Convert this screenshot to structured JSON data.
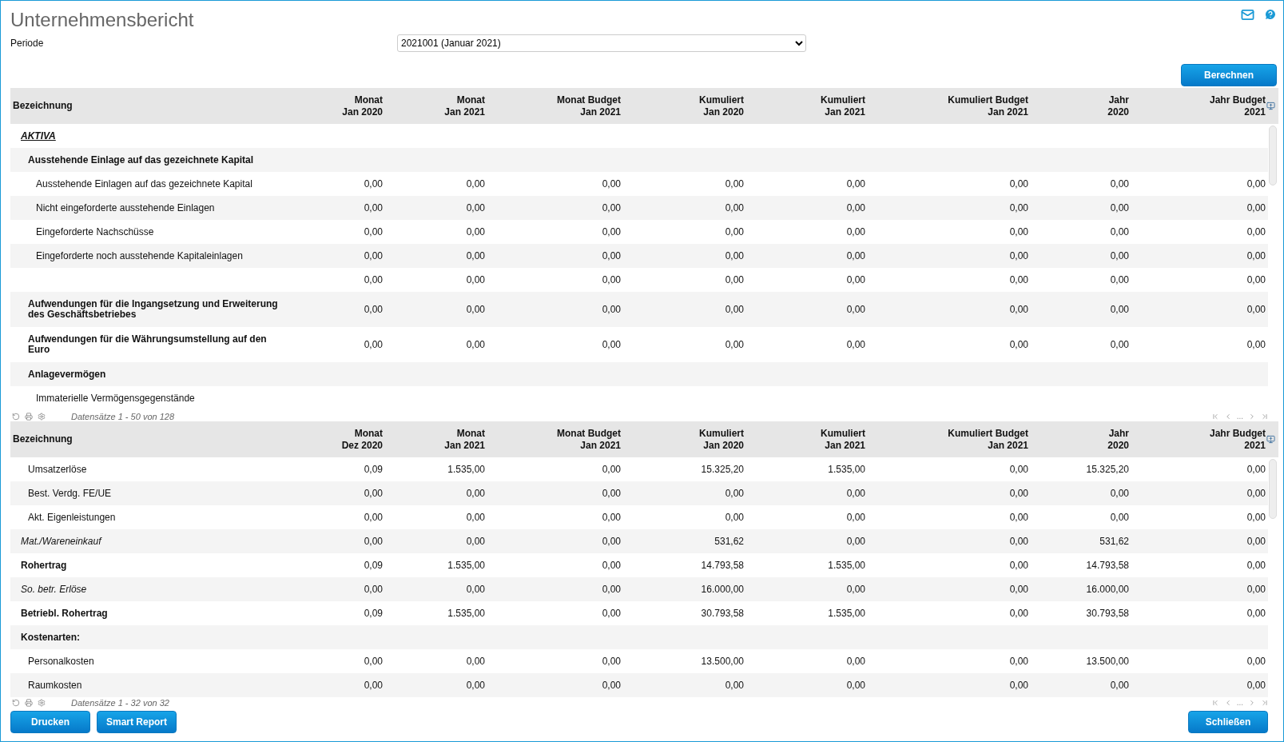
{
  "title": "Unternehmensbericht",
  "period": {
    "label": "Periode",
    "value": "2021001 (Januar 2021)"
  },
  "calculate_button": "Berechnen",
  "tables": [
    {
      "columns": [
        [
          "Bezeichnung"
        ],
        [
          "Monat",
          "Jan 2020"
        ],
        [
          "Monat",
          "Jan 2021"
        ],
        [
          "Monat Budget",
          "Jan 2021"
        ],
        [
          "Kumuliert",
          "Jan 2020"
        ],
        [
          "Kumuliert",
          "Jan 2021"
        ],
        [
          "Kumuliert Budget",
          "Jan 2021"
        ],
        [
          "Jahr",
          "2020"
        ],
        [
          "Jahr Budget",
          "2021"
        ]
      ],
      "rows": [
        {
          "kind": "section",
          "label": "AKTIVA"
        },
        {
          "kind": "group",
          "label": "Ausstehende Einlage auf das gezeichnete Kapital"
        },
        {
          "kind": "item",
          "label": "Ausstehende Einlagen auf das gezeichnete Kapital",
          "values": [
            "0,00",
            "0,00",
            "0,00",
            "0,00",
            "0,00",
            "0,00",
            "0,00",
            "0,00"
          ]
        },
        {
          "kind": "item",
          "label": "Nicht eingeforderte ausstehende Einlagen",
          "values": [
            "0,00",
            "0,00",
            "0,00",
            "0,00",
            "0,00",
            "0,00",
            "0,00",
            "0,00"
          ]
        },
        {
          "kind": "item",
          "label": "Eingeforderte Nachschüsse",
          "values": [
            "0,00",
            "0,00",
            "0,00",
            "0,00",
            "0,00",
            "0,00",
            "0,00",
            "0,00"
          ]
        },
        {
          "kind": "item",
          "label": "Eingeforderte noch ausstehende Kapitaleinlagen",
          "values": [
            "0,00",
            "0,00",
            "0,00",
            "0,00",
            "0,00",
            "0,00",
            "0,00",
            "0,00"
          ]
        },
        {
          "kind": "item",
          "values": [
            "0,00",
            "0,00",
            "0,00",
            "0,00",
            "0,00",
            "0,00",
            "0,00",
            "0,00"
          ]
        },
        {
          "kind": "group",
          "label": "Aufwendungen für die Ingangsetzung und Erweiterung des Geschäftsbetriebes",
          "values": [
            "0,00",
            "0,00",
            "0,00",
            "0,00",
            "0,00",
            "0,00",
            "0,00",
            "0,00"
          ]
        },
        {
          "kind": "group",
          "label": "Aufwendungen für die Währungsumstellung auf den Euro",
          "values": [
            "0,00",
            "0,00",
            "0,00",
            "0,00",
            "0,00",
            "0,00",
            "0,00",
            "0,00"
          ]
        },
        {
          "kind": "group",
          "label": "Anlagevermögen"
        },
        {
          "kind": "item",
          "label": "Immaterielle Vermögensgegenstände"
        }
      ],
      "records": "Datensätze 1 - 50 von 128"
    },
    {
      "columns": [
        [
          "Bezeichnung"
        ],
        [
          "Monat",
          "Dez 2020"
        ],
        [
          "Monat",
          "Jan 2021"
        ],
        [
          "Monat Budget",
          "Jan 2021"
        ],
        [
          "Kumuliert",
          "Jan 2020"
        ],
        [
          "Kumuliert",
          "Jan 2021"
        ],
        [
          "Kumuliert Budget",
          "Jan 2021"
        ],
        [
          "Jahr",
          "2020"
        ],
        [
          "Jahr Budget",
          "2021"
        ]
      ],
      "rows": [
        {
          "kind": "subitem",
          "label": "Umsatzerlöse",
          "values": [
            "0,09",
            "1.535,00",
            "0,00",
            "15.325,20",
            "1.535,00",
            "0,00",
            "15.325,20",
            "0,00"
          ]
        },
        {
          "kind": "subitem",
          "label": "Best. Verdg. FE/UE",
          "values": [
            "0,00",
            "0,00",
            "0,00",
            "0,00",
            "0,00",
            "0,00",
            "0,00",
            "0,00"
          ]
        },
        {
          "kind": "subitem",
          "label": "Akt. Eigenleistungen",
          "values": [
            "0,00",
            "0,00",
            "0,00",
            "0,00",
            "0,00",
            "0,00",
            "0,00",
            "0,00"
          ]
        },
        {
          "kind": "note",
          "label": "Mat./Wareneinkauf",
          "values": [
            "0,00",
            "0,00",
            "0,00",
            "531,62",
            "0,00",
            "0,00",
            "531,62",
            "0,00"
          ]
        },
        {
          "kind": "total",
          "label": "Rohertrag",
          "values": [
            "0,09",
            "1.535,00",
            "0,00",
            "14.793,58",
            "1.535,00",
            "0,00",
            "14.793,58",
            "0,00"
          ]
        },
        {
          "kind": "note",
          "label": "So. betr. Erlöse",
          "values": [
            "0,00",
            "0,00",
            "0,00",
            "16.000,00",
            "0,00",
            "0,00",
            "16.000,00",
            "0,00"
          ]
        },
        {
          "kind": "total",
          "label": "Betriebl. Rohertrag",
          "values": [
            "0,09",
            "1.535,00",
            "0,00",
            "30.793,58",
            "1.535,00",
            "0,00",
            "30.793,58",
            "0,00"
          ]
        },
        {
          "kind": "total",
          "label": "Kostenarten:"
        },
        {
          "kind": "subitem",
          "label": "Personalkosten",
          "values": [
            "0,00",
            "0,00",
            "0,00",
            "13.500,00",
            "0,00",
            "0,00",
            "13.500,00",
            "0,00"
          ]
        },
        {
          "kind": "subitem",
          "label": "Raumkosten",
          "values": [
            "0,00",
            "0,00",
            "0,00",
            "0,00",
            "0,00",
            "0,00",
            "0,00",
            "0,00"
          ]
        }
      ],
      "records": "Datensätze 1 - 32 von 32"
    }
  ],
  "pager_ellipsis": [
    "...",
    "..."
  ],
  "footer_buttons": [
    "Drucken",
    "Smart Report"
  ],
  "close_button": "Schließen"
}
